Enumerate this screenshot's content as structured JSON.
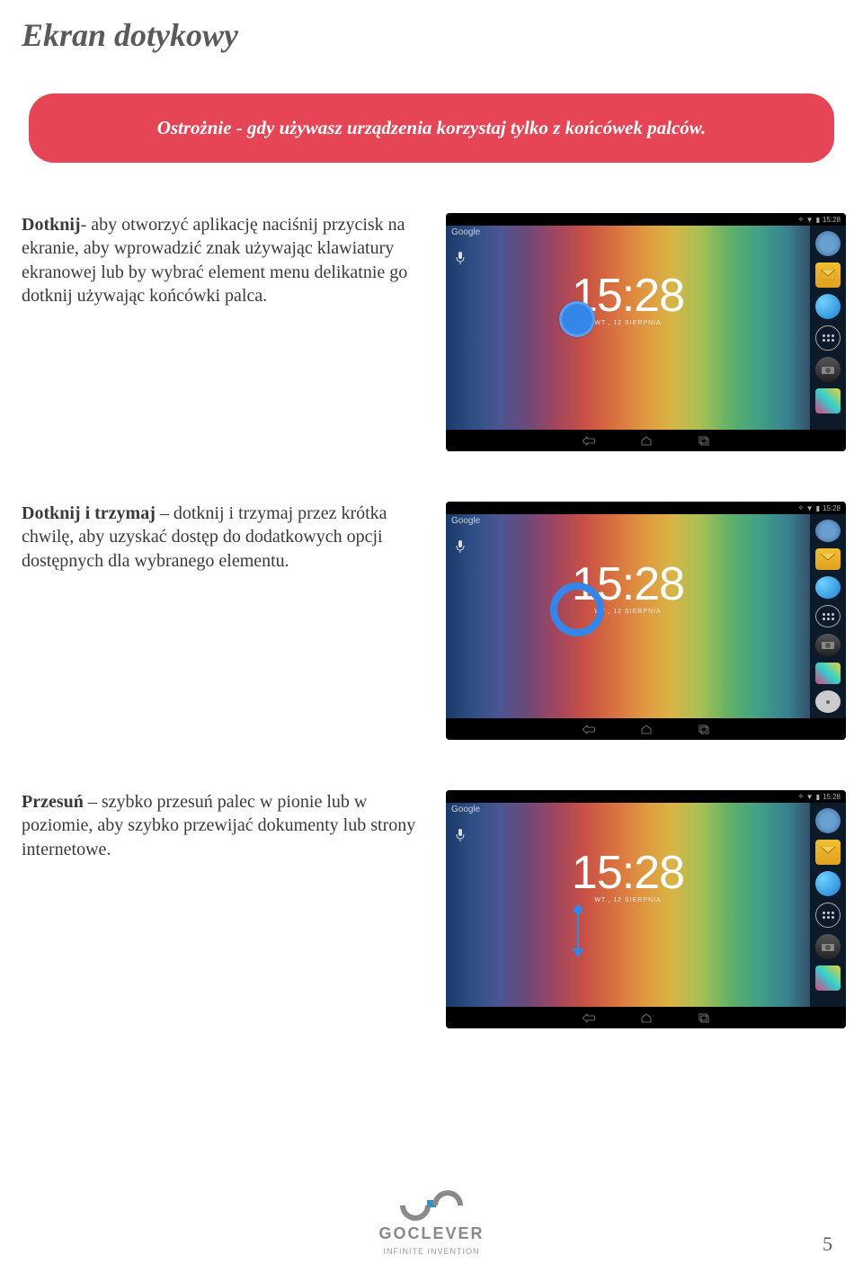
{
  "page": {
    "title": "Ekran dotykowy",
    "number": "5"
  },
  "warning": "Ostrożnie - gdy używasz urządzenia korzystaj tylko z końcówek palców.",
  "sections": [
    {
      "bold": "Dotknij",
      "rest": "- aby otworzyć aplikację naciśnij przycisk na ekranie, aby wprowadzić znak używając klawiatury ekranowej lub by wybrać element menu delikatnie go dotknij używając końcówki palca."
    },
    {
      "bold": "Dotknij i trzymaj",
      "rest": " – dotknij i trzymaj przez krótka chwilę, aby uzyskać dostęp do dodatkowych opcji dostępnych dla wybranego elementu."
    },
    {
      "bold": "Przesuń",
      "rest": " – szybko przesuń palec w pionie lub w poziomie, aby szybko przewijać dokumenty lub strony internetowe."
    }
  ],
  "tablet": {
    "status_time": "15:28",
    "google_label": "Google",
    "clock_time": "15:28",
    "clock_date": "WT., 12 SIERPNIA",
    "icons": {
      "camera": "camera-icon",
      "mail": "mail-icon",
      "browser": "browser-icon",
      "apps": "apps-grid-icon",
      "camera2": "camera-icon",
      "gallery": "gallery-icon",
      "settings": "gear-icon"
    }
  },
  "logo": {
    "brand": "GOCLEVER",
    "tagline": "INFINITE INVENTION"
  }
}
